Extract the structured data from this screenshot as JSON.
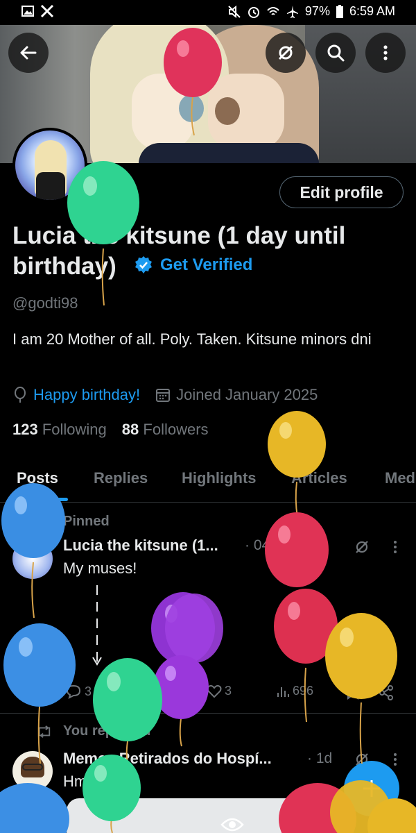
{
  "status_bar": {
    "battery": "97%",
    "time": "6:59 AM"
  },
  "profile": {
    "name": "Lucia the kitsune (1 day until birthday)",
    "get_verified": "Get Verified",
    "handle": "@godti98",
    "bio": "I am 20 Mother of all. Poly. Taken. Kitsune minors dni",
    "birthday_link": "Happy birthday!",
    "joined": "Joined January 2025",
    "following_count": "123",
    "following_label": "Following",
    "followers_count": "88",
    "followers_label": "Followers",
    "edit_button": "Edit profile"
  },
  "tabs": [
    "Posts",
    "Replies",
    "Highlights",
    "Articles",
    "Media"
  ],
  "posts": [
    {
      "context": "Pinned",
      "author": "Lucia the kitsune (1...",
      "date": "· 04 Apr 25",
      "text": "My muses!",
      "replies": "3",
      "likes": "3",
      "views": "696"
    },
    {
      "context": "You reposted",
      "author": "Memes Retirados do Hospí...",
      "date": "· 1d",
      "text": "Hmm"
    }
  ],
  "colors": {
    "accent": "#1d9bf0",
    "background": "#000000",
    "text": "#e7e9ea",
    "muted": "#71767b"
  }
}
